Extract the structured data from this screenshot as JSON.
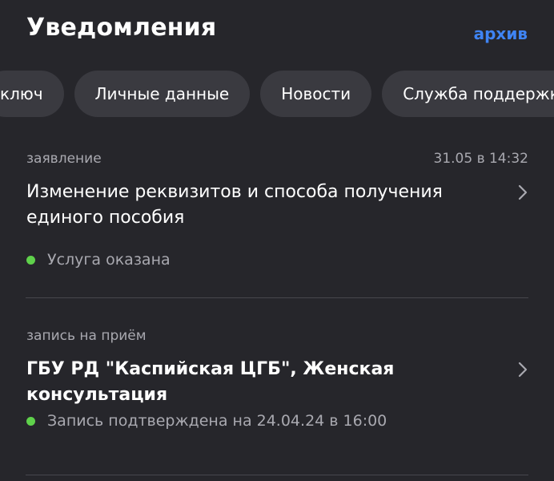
{
  "header": {
    "title": "Уведомления",
    "archive_label": "архив"
  },
  "filters": [
    {
      "label": "ключ"
    },
    {
      "label": "Личные данные"
    },
    {
      "label": "Новости"
    },
    {
      "label": "Служба поддержки"
    }
  ],
  "notifications": [
    {
      "category": "заявление",
      "time": "31.05 в 14:32",
      "title": "Изменение реквизитов и способа получения единого пособия",
      "status": "Услуга оказана"
    },
    {
      "category": "запись на приём",
      "time": "",
      "title": "ГБУ РД \"Каспийская ЦГБ\", Женская консультация",
      "status": "Запись подтверждена на 24.04.24 в 16:00"
    }
  ],
  "colors": {
    "background": "#26262b",
    "chip": "#3a3a40",
    "accent": "#3f84f4",
    "status_ok": "#5fd14b",
    "muted_text": "#a9a9b0"
  },
  "icons": {
    "chevron": "chevron-right-icon",
    "status": "status-dot-icon"
  }
}
